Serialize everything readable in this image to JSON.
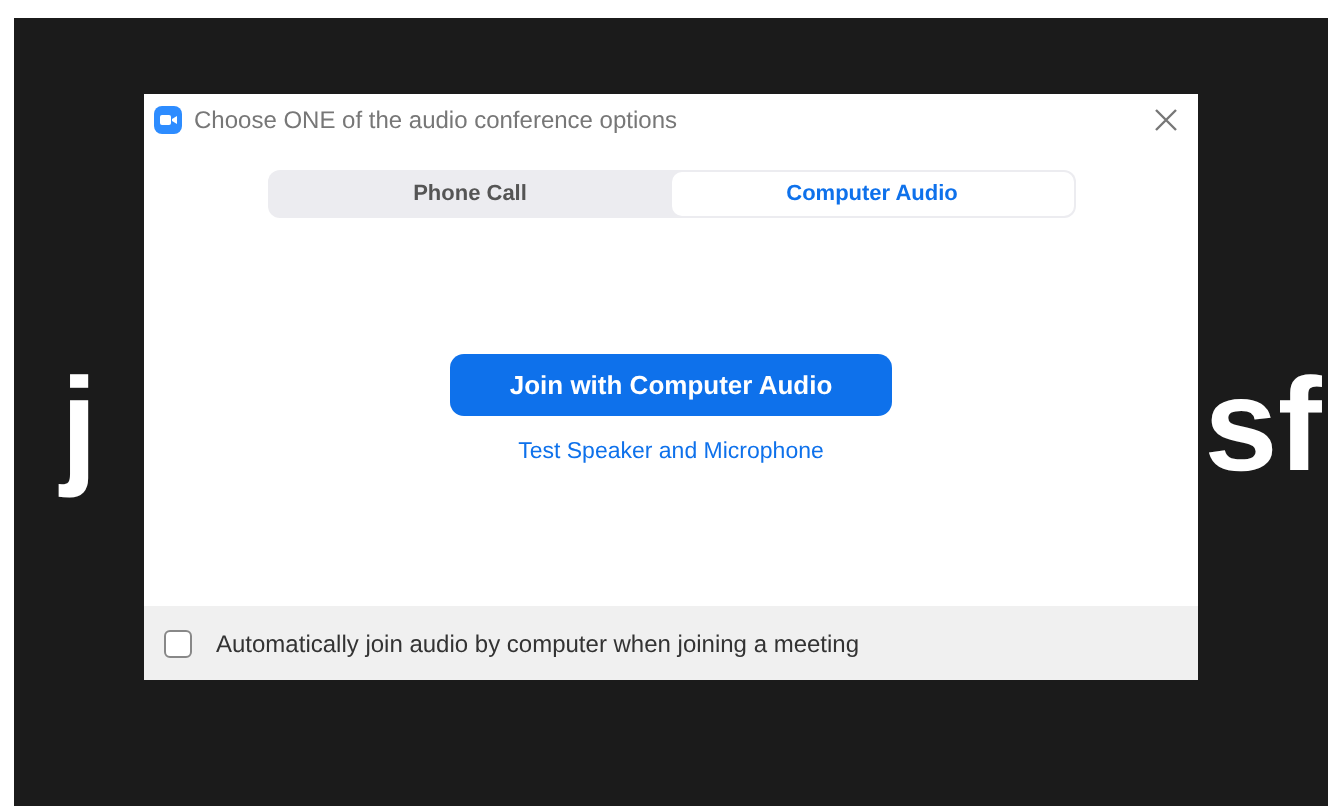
{
  "background_text": {
    "left": "j",
    "right": "sf"
  },
  "dialog": {
    "title": "Choose ONE of the audio conference options",
    "tabs": [
      {
        "label": "Phone Call",
        "selected": false
      },
      {
        "label": "Computer Audio",
        "selected": true
      }
    ],
    "join_button": "Join with Computer Audio",
    "test_link": "Test Speaker and Microphone",
    "auto_join": {
      "label": "Automatically join audio by computer when joining a meeting",
      "checked": false
    }
  }
}
